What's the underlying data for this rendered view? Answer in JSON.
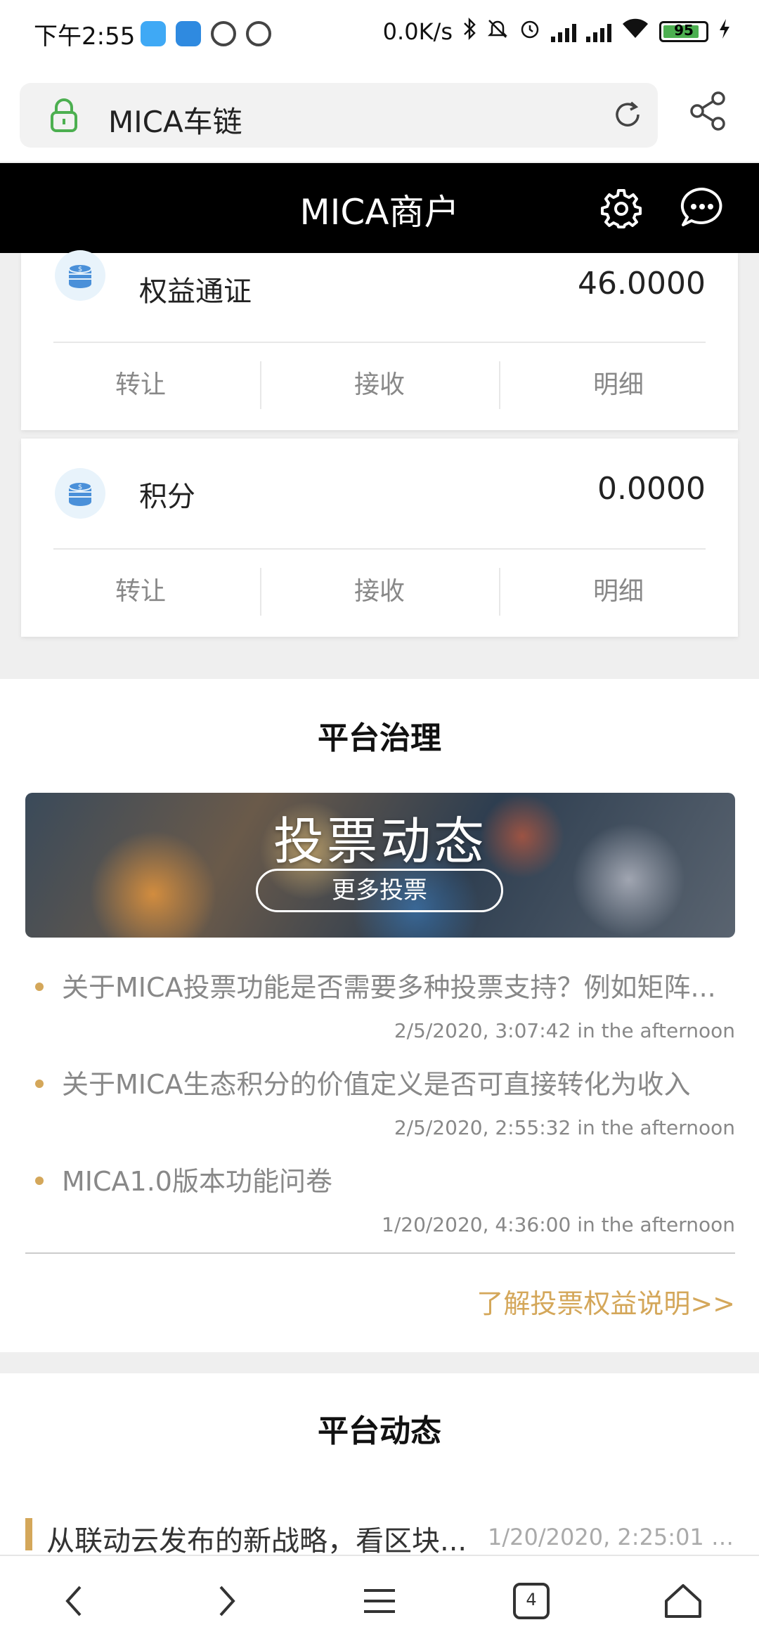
{
  "status_bar": {
    "time": "下午2:55",
    "network_speed": "0.0K/s",
    "battery": "95",
    "icons": [
      "bluetooth-icon",
      "mute-icon",
      "alarm-icon",
      "signal-icon",
      "signal-icon",
      "wifi-icon",
      "battery-icon",
      "charging-icon"
    ]
  },
  "browser": {
    "url_title": "MICA车链",
    "icons": [
      "lock-icon",
      "reload-icon",
      "share-icon"
    ]
  },
  "header": {
    "title": "MICA商户",
    "icons": [
      "gear-icon",
      "chat-icon"
    ]
  },
  "assets": [
    {
      "name": "权益通证",
      "value": "46.0000",
      "icon": "coin-stack-icon",
      "actions": [
        "转让",
        "接收",
        "明细"
      ]
    },
    {
      "name": "积分",
      "value": "0.0000",
      "icon": "coin-stack-icon",
      "actions": [
        "转让",
        "接收",
        "明细"
      ]
    }
  ],
  "governance": {
    "title": "平台治理",
    "banner_title": "投票动态",
    "banner_button": "更多投票",
    "votes": [
      {
        "title": "关于MICA投票功能是否需要多种投票支持？例如矩阵...",
        "time": "2/5/2020, 3:07:42 in the afternoon"
      },
      {
        "title": "关于MICA生态积分的价值定义是否可直接转化为收入",
        "time": "2/5/2020, 2:55:32 in the afternoon"
      },
      {
        "title": "MICA1.0版本功能问卷",
        "time": "1/20/2020, 4:36:00 in the afternoon"
      }
    ],
    "link": "了解投票权益说明>>"
  },
  "news": {
    "title": "平台动态",
    "items": [
      {
        "title": "从联动云发布的新战略，看区块...",
        "time": "1/20/2020, 2:25:01 in..."
      }
    ]
  },
  "bottom_nav": {
    "tab_count": "4",
    "icons": [
      "back-icon",
      "forward-icon",
      "menu-icon",
      "tabs-icon",
      "home-icon"
    ]
  },
  "colors": {
    "accent_gold": "#d4a75a",
    "header_bg": "#000000",
    "coin_blue": "#4a90d9",
    "lock_green": "#4caf50"
  }
}
